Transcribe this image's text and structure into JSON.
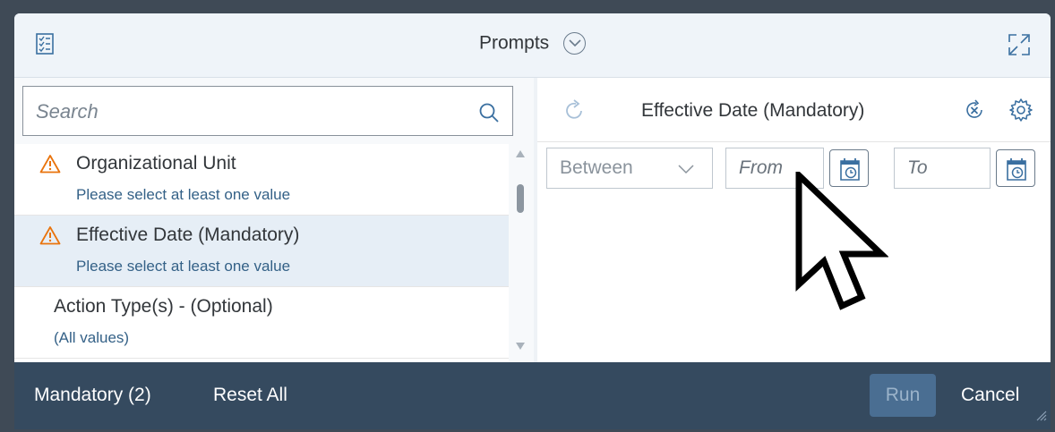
{
  "header": {
    "title": "Prompts"
  },
  "search": {
    "placeholder": "Search"
  },
  "prompts": [
    {
      "label": "Organizational Unit",
      "status": "Please select at least one value",
      "warning": true,
      "selected": false
    },
    {
      "label": "Effective Date (Mandatory)",
      "status": "Please select at least one value",
      "warning": true,
      "selected": true
    },
    {
      "label": "Action Type(s) - (Optional)",
      "status": "(All values)",
      "warning": false,
      "selected": false
    }
  ],
  "detail": {
    "title": "Effective Date (Mandatory)",
    "operator": "Between",
    "from_placeholder": "From",
    "to_placeholder": "To"
  },
  "footer": {
    "mandatory_label": "Mandatory (2)",
    "reset_label": "Reset All",
    "run_label": "Run",
    "cancel_label": "Cancel"
  },
  "colors": {
    "header_bg": "#eff4f9",
    "footer_bg": "#354a5f",
    "warning": "#e9730c",
    "link": "#346187",
    "selected_row": "#e6eef6"
  }
}
